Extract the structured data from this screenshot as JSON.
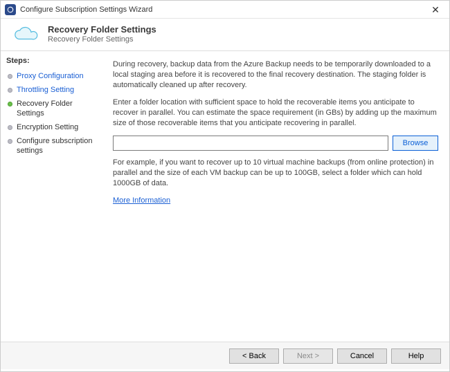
{
  "window": {
    "title": "Configure Subscription Settings Wizard"
  },
  "header": {
    "title": "Recovery Folder Settings",
    "subtitle": "Recovery Folder Settings"
  },
  "sidebar": {
    "steps_label": "Steps:",
    "items": [
      {
        "label": "Proxy Configuration"
      },
      {
        "label": "Throttling Setting"
      },
      {
        "label": "Recovery Folder Settings"
      },
      {
        "label": "Encryption Setting"
      },
      {
        "label": "Configure subscription settings"
      }
    ]
  },
  "content": {
    "p1": "During recovery, backup data from the Azure Backup needs to be temporarily downloaded to a local staging area before it is recovered to the final recovery destination. The staging folder is automatically cleaned up after recovery.",
    "p2": "Enter a folder location with sufficient space to hold the recoverable items you anticipate to recover in parallel. You can estimate the space requirement (in GBs) by adding up the maximum size of those recoverable items that you anticipate recovering in parallel.",
    "folder_value": "",
    "browse_label": "Browse",
    "example": "For example, if you want to recover up to 10 virtual machine backups (from online protection) in parallel and the size of each VM backup can be up to 100GB, select a folder which can hold 1000GB of data.",
    "more_info": "More Information"
  },
  "footer": {
    "back": "< Back",
    "next": "Next >",
    "cancel": "Cancel",
    "help": "Help"
  }
}
